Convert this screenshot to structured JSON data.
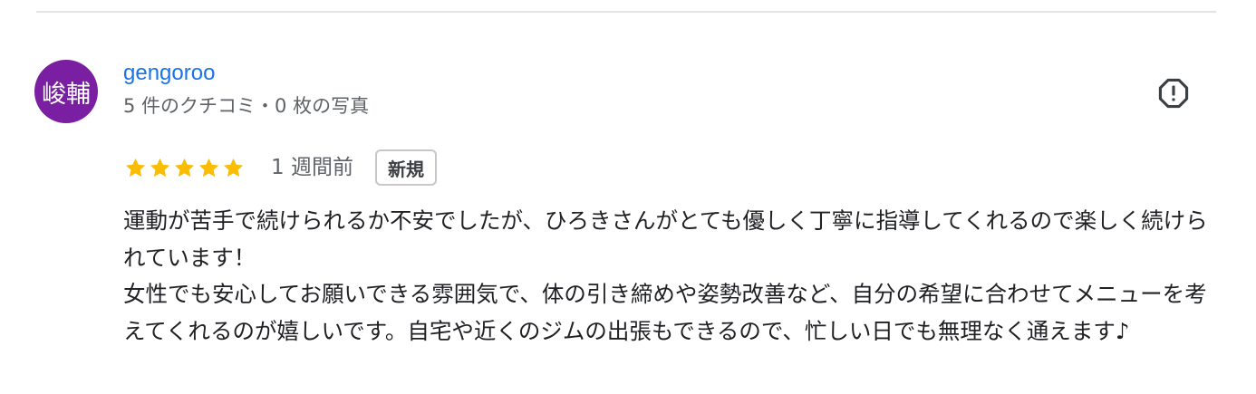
{
  "review": {
    "author": {
      "avatar_text": "峻輔",
      "avatar_color": "#7b1fa2",
      "name": "gengoroo",
      "meta": "5 件のクチコミ・0 枚の写真"
    },
    "report_icon": "report-flag-octagon-icon",
    "rating": {
      "stars": 5,
      "max_stars": 5,
      "star_color": "#fbbc04"
    },
    "time_ago": "1 週間前",
    "badge": "新規",
    "text": "運動が苦手で続けられるか不安でしたが、ひろきさんがとても優しく丁寧に指導してくれるので楽しく続けられています！\n女性でも安心してお願いできる雰囲気で、体の引き締めや姿勢改善など、自分の希望に合わせてメニューを考えてくれるのが嬉しいです。自宅や近くのジムの出張もできるので、忙しい日でも無理なく通えます♪"
  },
  "colors": {
    "link": "#1a73e8",
    "secondary_text": "#5f6368",
    "divider": "#e3e3e3"
  }
}
